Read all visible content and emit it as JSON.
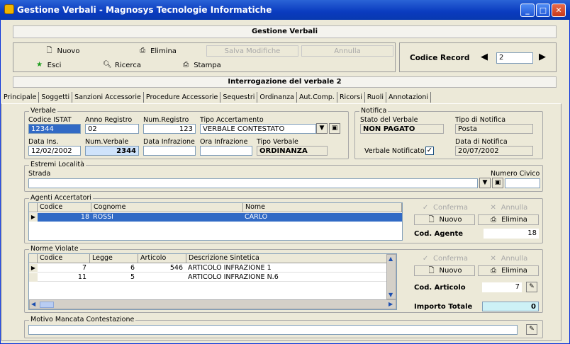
{
  "window": {
    "title": "Gestione Verbali  -  Magnosys Tecnologie Informatiche",
    "minimize": "_",
    "maximize": "□",
    "close": "✕"
  },
  "header": {
    "title": "Gestione Verbali"
  },
  "toolbar": {
    "nuovo": "Nuovo",
    "elimina": "Elimina",
    "salva": "Salva Modifiche",
    "annulla": "Annulla",
    "esci": "Esci",
    "ricerca": "Ricerca",
    "stampa": "Stampa"
  },
  "codice_record": {
    "label": "Codice Record",
    "value": "2",
    "prev": "◀",
    "next": "▶"
  },
  "subheader": {
    "title": "Interrogazione del verbale 2"
  },
  "tabs": [
    "Principale",
    "Soggetti",
    "Sanzioni Accessorie",
    "Procedure Accessorie",
    "Sequestri",
    "Ordinanza",
    "Aut.Comp.",
    "Ricorsi",
    "Ruoli",
    "Annotazioni"
  ],
  "verbale": {
    "group": "Verbale",
    "codice_istat_label": "Codice ISTAT",
    "codice_istat": "12344",
    "anno_label": "Anno Registro",
    "anno": "02",
    "num_registro_label": "Num.Registro",
    "num_registro": "123",
    "tipo_acc_label": "Tipo Accertamento",
    "tipo_acc": "VERBALE CONTESTATO",
    "data_ins_label": "Data Ins.",
    "data_ins": "12/02/2002",
    "num_verbale_label": "Num.Verbale",
    "num_verbale": "2344",
    "data_infr_label": "Data Infrazione",
    "data_infr": "",
    "ora_infr_label": "Ora Infrazione",
    "ora_infr": "",
    "tipo_verbale_label": "Tipo Verbale",
    "tipo_verbale": "ORDINANZA"
  },
  "notifica": {
    "group": "Notifica",
    "stato_label": "Stato del Verbale",
    "stato": "NON PAGATO",
    "tipo_label": "Tipo di Notifica",
    "tipo": "Posta",
    "notificato_label": "Verbale Notificato",
    "notificato_check": "✓",
    "data_label": "Data di Notifica",
    "data": "20/07/2002"
  },
  "localita": {
    "group": "Estremi Località",
    "strada_label": "Strada",
    "strada": "",
    "civico_label": "Numero Civico",
    "civico": ""
  },
  "agenti": {
    "group": "Agenti Accertatori",
    "columns": [
      "Codice",
      "Cognome",
      "Nome"
    ],
    "rows": [
      [
        "18",
        "ROSSI",
        "CARLO"
      ]
    ],
    "conferma": "Conferma",
    "annulla": "Annulla",
    "nuovo": "Nuovo",
    "elimina": "Elimina",
    "cod_label": "Cod. Agente",
    "cod": "18"
  },
  "norme": {
    "group": "Norme Violate",
    "columns": [
      "Codice",
      "Legge",
      "Articolo",
      "Descrizione Sintetica"
    ],
    "rows": [
      [
        "7",
        "6",
        "546",
        "ARTICOLO INFRAZIONE 1"
      ],
      [
        "11",
        "5",
        "",
        "ARTICOLO INFRAZIONE N.6"
      ]
    ],
    "conferma": "Conferma",
    "annulla": "Annulla",
    "nuovo": "Nuovo",
    "elimina": "Elimina",
    "cod_label": "Cod. Articolo",
    "cod": "7",
    "importo_label": "Importo Totale",
    "importo": "0"
  },
  "motivo": {
    "group": "Motivo Mancata Contestazione",
    "value": ""
  }
}
